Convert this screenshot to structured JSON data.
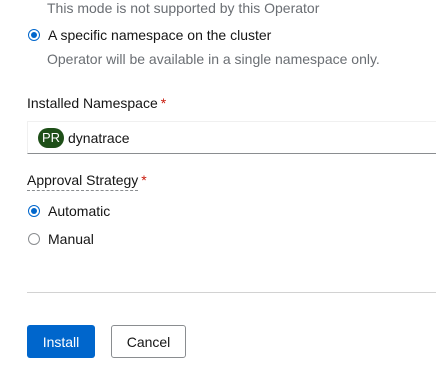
{
  "install_mode": {
    "all_namespaces_helper": "This mode is not supported by this Operator",
    "specific_namespace_label": "A specific namespace on the cluster",
    "specific_namespace_helper": "Operator will be available in a single namespace only.",
    "selected": "specific_namespace"
  },
  "installed_namespace": {
    "label": "Installed Namespace",
    "required_marker": "*",
    "badge": "PR",
    "value": "dynatrace",
    "badge_color": "#1e4f18"
  },
  "approval_strategy": {
    "label": "Approval Strategy",
    "required_marker": "*",
    "options": [
      {
        "label": "Automatic",
        "selected": true
      },
      {
        "label": "Manual",
        "selected": false
      }
    ]
  },
  "actions": {
    "install_label": "Install",
    "cancel_label": "Cancel"
  },
  "colors": {
    "accent": "#0066cc",
    "required": "#c9190b",
    "helper_text": "#6a6e73"
  }
}
